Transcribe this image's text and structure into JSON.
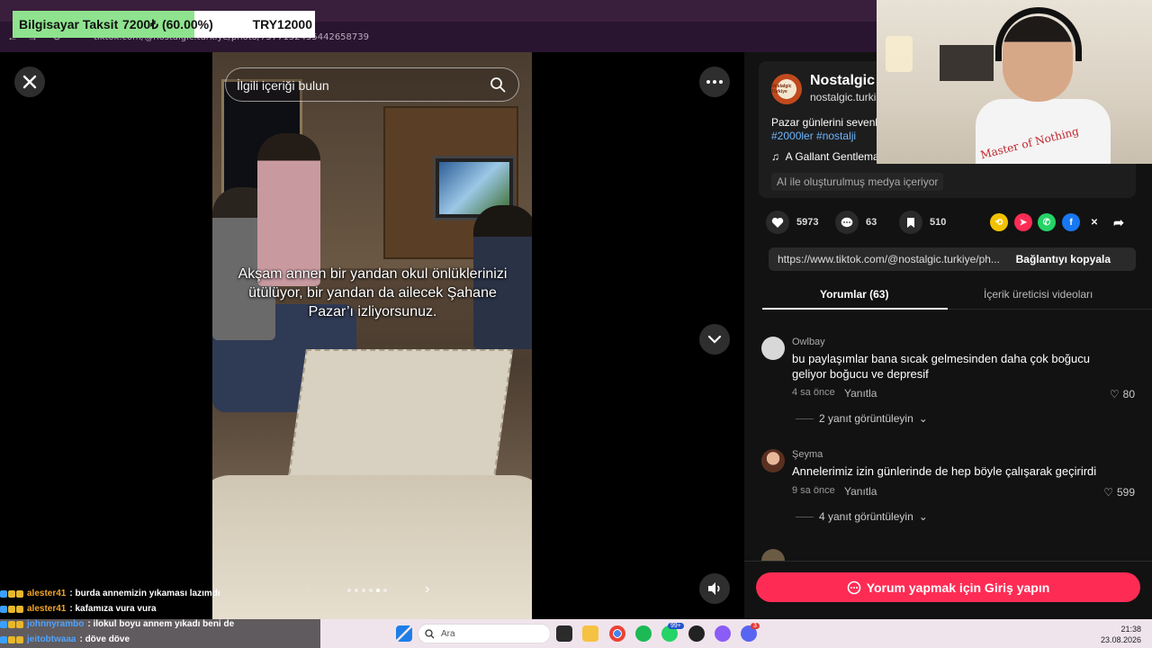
{
  "overlay": {
    "goal_label": "Bilgisayar Taksit",
    "goal_amount": "7200₺ (60.00%)",
    "goal_target": "TRY12000",
    "goal_progress": 0.6
  },
  "browser": {
    "url": "tiktok.com/@nostalgic.turkiye/photo/7577152455442658739"
  },
  "player": {
    "search_placeholder": "İlgili içeriği bulun",
    "caption": "Akşam annen bir yandan okul önlüklerinizi ütülüyor, bir yandan da ailecek Şahane Pazar’ı izliyorsunuz.",
    "carousel_total": 6,
    "carousel_active": 5
  },
  "post": {
    "avatar_text": "Nostalgic Türkiye",
    "author": "Nostalgic T",
    "handle": "nostalgic.turki",
    "description": "Pazar günlerini sevenle",
    "tags": "#2000ler #nostalji",
    "music": "A Gallant Gentlema",
    "ai_label": "AI ile oluşturulmuş medya içeriyor",
    "likes": "5973",
    "comments": "63",
    "saves": "510",
    "link": "https://www.tiktok.com/@nostalgic.turkiye/ph...",
    "copy_label": "Bağlantıyı kopyala"
  },
  "tabs": {
    "comments": "Yorumlar (63)",
    "creator_videos": "İçerik üreticisi videoları"
  },
  "comments": [
    {
      "user": "Owlbay",
      "text": "bu paylaşımlar bana sıcak gelmesinden daha çok boğucu geliyor boğucu ve depresif",
      "time": "4 sa önce",
      "reply": "Yanıtla",
      "likes": "80",
      "more": "2 yanıt görüntüleyin"
    },
    {
      "user": "Şeyma",
      "text": "Annelerimiz izin günlerinde de hep böyle çalışarak geçirirdi",
      "time": "9 sa önce",
      "reply": "Yanıtla",
      "likes": "599",
      "more": "4 yanıt görüntüleyin"
    }
  ],
  "login_label": "Yorum yapmak için Giriş yapın",
  "webcam": {
    "shirt_text": "Master of Nothing"
  },
  "chat": [
    {
      "name": "alester41",
      "msg": ": burda annemizin yıkaması lazımdı"
    },
    {
      "name": "alester41",
      "msg": ": kafamıza vura vura"
    },
    {
      "name": "johnnyrambo",
      "msg": ": ilokul boyu annem yıkadı beni de"
    },
    {
      "name": "jeitobtwaaa",
      "msg": ": döve döve"
    }
  ],
  "taskbar": {
    "search": "Ara",
    "whatsapp_badge": "99+",
    "discord_badge": "3",
    "time": "21:38",
    "date": "23.08.2026"
  },
  "colors": {
    "accent": "#fe2c55",
    "tag": "#6cb6ff",
    "chat_name": "#f4a62a",
    "goal_fill": "#8fe38f"
  }
}
